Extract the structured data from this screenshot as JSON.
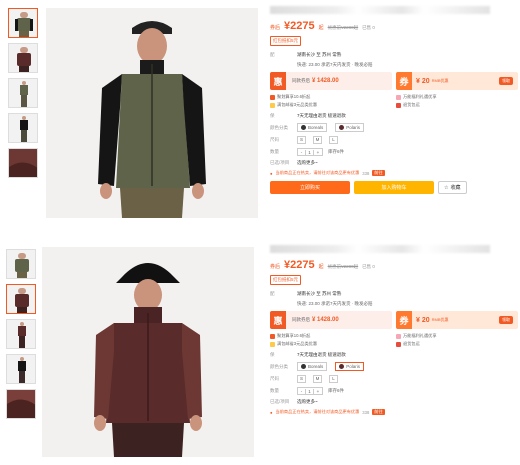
{
  "panels": [
    {
      "price_prefix": "券后",
      "price": "¥2275",
      "price_unit": "起",
      "original_price": "优惠前¥2280起",
      "sold": "已售 0",
      "red_tag": "红包抵扣5元",
      "delivery_label": "配",
      "delivery": "湖南长沙 至 苏州 常熟",
      "delivery_note": "快递: 23.00  承诺7天内发货 · 晚发必赔",
      "promo_hui": {
        "badge": "惠",
        "label": "同款券后",
        "amount": "¥ 1428.00"
      },
      "promo_quan": {
        "badge": "券",
        "amount": "¥ 20",
        "note": "RMB优惠",
        "btn": "领取"
      },
      "sub_items": [
        "聚划算享10.6折起",
        "万能福利礼遇优享",
        "满包邮省3元品类优惠",
        "退货包运"
      ],
      "service_label": "保",
      "service": "7天无理由退货 极速退款",
      "color_label": "颜色分类",
      "colors": [
        "Boreals",
        "Polaris"
      ],
      "size_label": "尺码",
      "sizes": [
        "S",
        "M",
        "L"
      ],
      "qty_label": "数量",
      "qty": [
        "-",
        "1",
        "+"
      ],
      "qty_note": "库存6件",
      "chosen_label": "已选/项目",
      "chosen": "选购更多~",
      "alert": "当前商品正在热卖，请前往对该商品更有优惠",
      "alert_count": "338",
      "alert_btn": "前往",
      "buy": "立即购买",
      "cart": "加入购物车",
      "fav": "收藏"
    },
    {
      "price_prefix": "券后",
      "price": "¥2275",
      "price_unit": "起",
      "original_price": "优惠前¥2280起",
      "sold": "已售 0",
      "red_tag": "红包抵扣5元",
      "delivery_label": "配",
      "delivery": "湖南长沙 至 苏州 常熟",
      "delivery_note": "快递: 23.00  承诺7天内发货 · 晚发必赔",
      "promo_hui": {
        "badge": "惠",
        "label": "同款券后",
        "amount": "¥ 1428.00"
      },
      "promo_quan": {
        "badge": "券",
        "amount": "¥ 20",
        "note": "RMB优惠",
        "btn": "领取"
      },
      "sub_items": [
        "聚划算享10.6折起",
        "万能福利礼遇优享",
        "满包邮省3元品类优惠",
        "退货包运"
      ],
      "service_label": "保",
      "service": "7天无理由退货 极速退款",
      "color_label": "颜色分类",
      "colors": [
        "Boreals",
        "Polaris"
      ],
      "size_label": "尺码",
      "sizes": [
        "S",
        "M",
        "L"
      ],
      "qty_label": "数量",
      "qty": [
        "-",
        "1",
        "+"
      ],
      "qty_note": "库存6件",
      "chosen_label": "已选/项目",
      "chosen": "选购更多~",
      "alert": "当前商品正在热卖，请前往对该商品更有优惠",
      "alert_count": "338",
      "alert_btn": "前往"
    }
  ],
  "colors": {
    "accent": "#f15a24",
    "jacket_green": "#5e6349",
    "jacket_black": "#151515",
    "jacket_maroon": "#5a2b2b",
    "jacket_burgundy": "#6d3834"
  }
}
